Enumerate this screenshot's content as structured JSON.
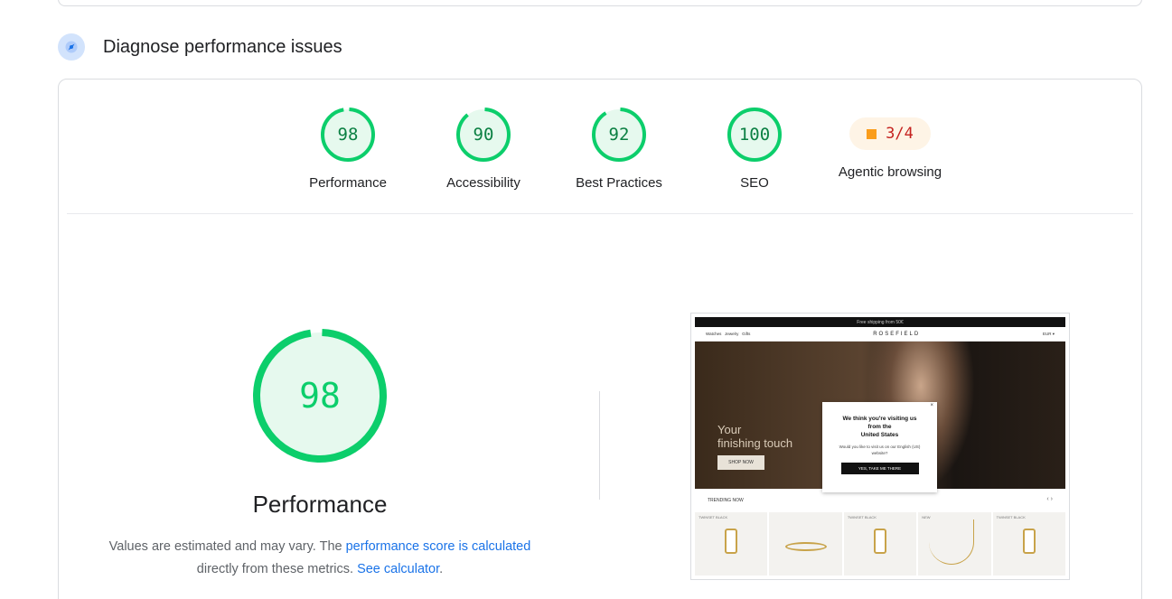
{
  "section": {
    "title": "Diagnose performance issues",
    "icon": "compass-icon"
  },
  "gauges": [
    {
      "label": "Performance",
      "score": "98",
      "fraction": 0.98,
      "color": "#0cce6b"
    },
    {
      "label": "Accessibility",
      "score": "90",
      "fraction": 0.9,
      "color": "#0cce6b"
    },
    {
      "label": "Best Practices",
      "score": "92",
      "fraction": 0.92,
      "color": "#0cce6b"
    },
    {
      "label": "SEO",
      "score": "100",
      "fraction": 1.0,
      "color": "#0cce6b"
    }
  ],
  "agentic": {
    "label": "Agentic browsing",
    "value": "3/4",
    "color": "#fa9d1b"
  },
  "performance": {
    "score": "98",
    "fraction": 0.98,
    "title": "Performance",
    "note_text_1": "Values are estimated and may vary. The ",
    "note_link_1": "performance score is calculated",
    "note_text_2": " directly from these metrics. ",
    "note_link_2": "See calculator",
    "note_text_3": "."
  },
  "screenshot": {
    "topbar": "Free shipping from 50€",
    "nav": [
      "Watches",
      "Jewelry",
      "Gifts"
    ],
    "logo": "ROSEFIELD",
    "nav_right": "EUR ▾",
    "hero_text_1": "Your",
    "hero_text_2": "finishing touch",
    "shop_button": "SHOP NOW",
    "popup_title_1": "We think you're visiting us",
    "popup_title_2": "from the",
    "popup_title_3": "United States",
    "popup_body": "Would you like to visit us on our English (US) website?",
    "popup_button": "YES, TAKE ME THERE",
    "popup_close": "×",
    "trending": "TRENDING NOW",
    "arrows": "‹  ›",
    "product_tags": [
      "TWINSET BLACK",
      "",
      "TWINSET BLACK",
      "NEW",
      "TWINSET BLACK"
    ]
  },
  "colors": {
    "pass": "#0cce6b",
    "pass_text": "#0b8043",
    "link": "#1a73e8"
  }
}
